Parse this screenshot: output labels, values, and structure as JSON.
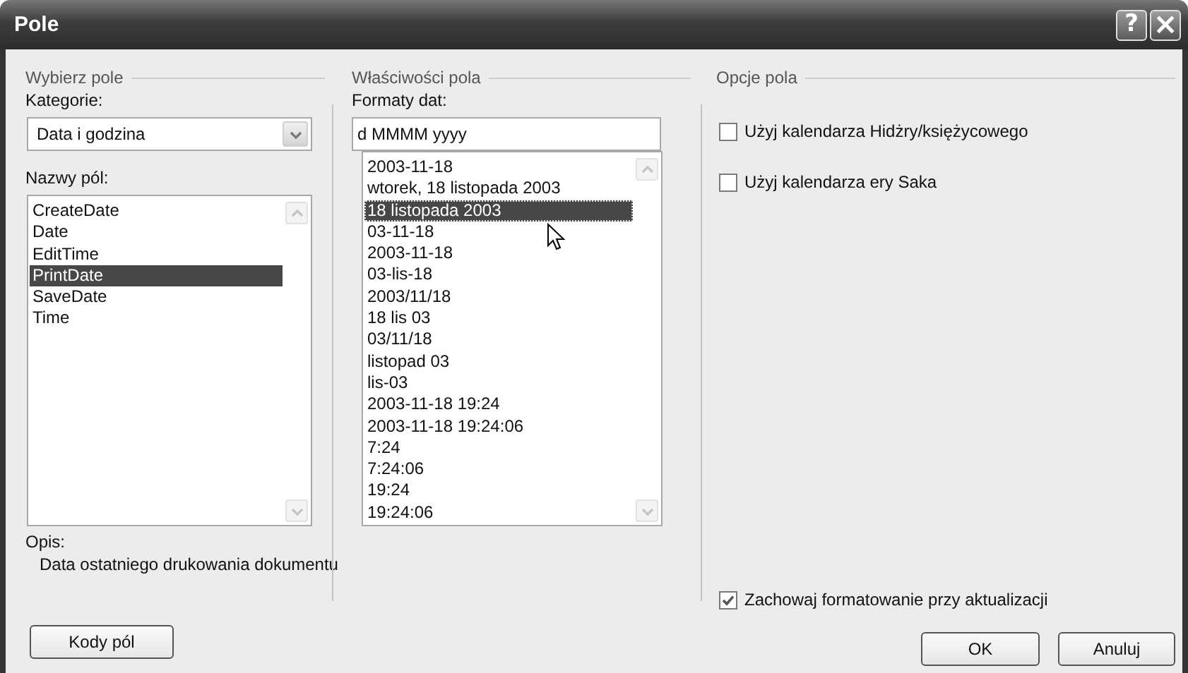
{
  "window": {
    "title": "Pole",
    "title_buttons": [
      {
        "kind": "help",
        "label": "?"
      },
      {
        "kind": "close",
        "label": "×"
      }
    ]
  },
  "select_field": {
    "label": "Wybierz pole",
    "category_label": "Kategorie:",
    "category": "Data i godzina",
    "names_label": "Nazwy pól:",
    "names": [
      {
        "label": "CreateDate",
        "selected": false
      },
      {
        "label": "Date",
        "selected": false
      },
      {
        "label": "EditTime",
        "selected": false
      },
      {
        "label": "PrintDate",
        "selected": true
      },
      {
        "label": "SaveDate",
        "selected": false
      },
      {
        "label": "Time",
        "selected": false
      }
    ]
  },
  "description": {
    "label": "Opis:",
    "text": "Data ostatniego drukowania dokumentu"
  },
  "field_properties": {
    "label": "Właściwości pola",
    "formats_label": "Formaty dat:",
    "format_value": "d MMMM yyyy",
    "formats": [
      {
        "label": "2003-11-18",
        "selected": false
      },
      {
        "label": "wtorek, 18 listopada 2003",
        "selected": false
      },
      {
        "label": "18 listopada 2003",
        "selected": true
      },
      {
        "label": "03-11-18",
        "selected": false
      },
      {
        "label": "2003-11-18",
        "selected": false
      },
      {
        "label": "03-lis-18",
        "selected": false
      },
      {
        "label": "2003/11/18",
        "selected": false
      },
      {
        "label": "18 lis 03",
        "selected": false
      },
      {
        "label": "03/11/18",
        "selected": false
      },
      {
        "label": "listopad 03",
        "selected": false
      },
      {
        "label": "lis-03",
        "selected": false
      },
      {
        "label": "2003-11-18 19:24",
        "selected": false
      },
      {
        "label": "2003-11-18 19:24:06",
        "selected": false
      },
      {
        "label": "7:24",
        "selected": false
      },
      {
        "label": "7:24:06",
        "selected": false
      },
      {
        "label": "19:24",
        "selected": false
      },
      {
        "label": "19:24:06",
        "selected": false
      }
    ]
  },
  "field_options": {
    "label": "Opcje pola",
    "options": [
      {
        "label": "Użyj kalendarza Hidżry/księżycowego",
        "checked": false
      },
      {
        "label": "Użyj kalendarza ery Saka",
        "checked": false
      }
    ],
    "preserve_formatting": {
      "label": "Zachowaj formatowanie przy aktualizacji",
      "checked": true
    }
  },
  "buttons": {
    "field_codes": "Kody pól",
    "ok": "OK",
    "cancel": "Anuluj"
  }
}
